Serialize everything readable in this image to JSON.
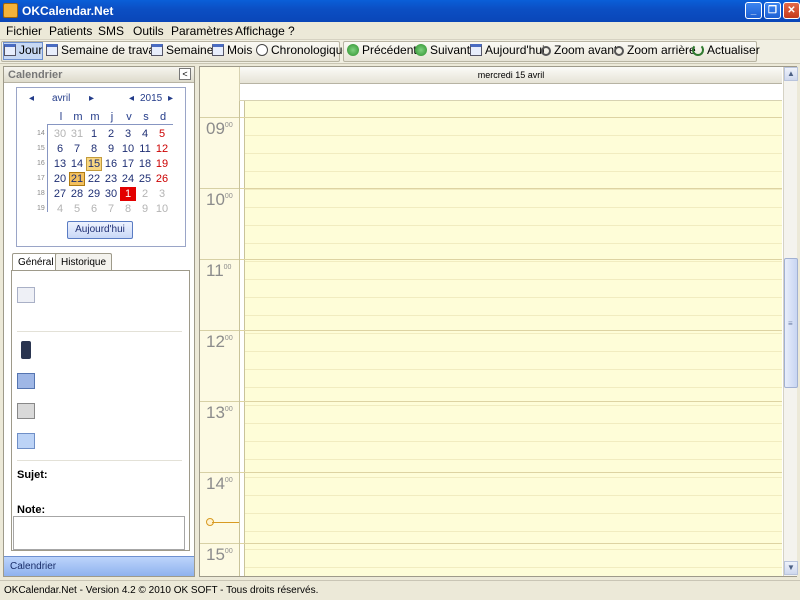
{
  "window": {
    "title": "OKCalendar.Net",
    "controls": [
      "_",
      "❐",
      "✕"
    ]
  },
  "menu": [
    "Fichier",
    "Patients",
    "SMS",
    "Outils",
    "Paramètres",
    "Affichage",
    "?"
  ],
  "toolbar": {
    "views": [
      "Jour",
      "Semaine de travail",
      "Semaine",
      "Mois",
      "Chronologique"
    ],
    "active_view": "Jour",
    "actions": [
      "Précédent",
      "Suivant",
      "Aujourd'hui",
      "Zoom avant",
      "Zoom arrière",
      "Actualiser"
    ]
  },
  "left_panel": {
    "header": "Calendrier",
    "collapse_glyph": "<",
    "calendar": {
      "month": "avril",
      "year": "2015",
      "nav_prev": "◂",
      "nav_next": "▸",
      "dow": [
        "l",
        "m",
        "m",
        "j",
        "v",
        "s",
        "d"
      ],
      "weeks": [
        {
          "num": "14",
          "days": [
            "30",
            "31",
            "1",
            "2",
            "3",
            "4",
            "5"
          ]
        },
        {
          "num": "15",
          "days": [
            "6",
            "7",
            "8",
            "9",
            "10",
            "11",
            "12"
          ]
        },
        {
          "num": "16",
          "days": [
            "13",
            "14",
            "15",
            "16",
            "17",
            "18",
            "19"
          ]
        },
        {
          "num": "17",
          "days": [
            "20",
            "21",
            "22",
            "23",
            "24",
            "25",
            "26"
          ]
        },
        {
          "num": "18",
          "days": [
            "27",
            "28",
            "29",
            "30",
            "1",
            "2",
            "3"
          ]
        },
        {
          "num": "19",
          "days": [
            "4",
            "5",
            "6",
            "7",
            "8",
            "9",
            "10"
          ]
        }
      ],
      "today_button": "Aujourd'hui"
    },
    "tabs": [
      "Général",
      "Historique"
    ],
    "active_tab": "Général",
    "subject_label": "Sujet:",
    "note_label": "Note:",
    "footer": "Calendrier"
  },
  "day_view": {
    "header": "mercredi 15 avril",
    "hours": [
      {
        "h": "09",
        "m": "00"
      },
      {
        "h": "10",
        "m": "00"
      },
      {
        "h": "11",
        "m": "00"
      },
      {
        "h": "12",
        "m": "00"
      },
      {
        "h": "13",
        "m": "00"
      },
      {
        "h": "14",
        "m": "00"
      },
      {
        "h": "15",
        "m": "00"
      }
    ]
  },
  "status_bar": "OKCalendar.Net - Version 4.2 © 2010 OK SOFT - Tous droits réservés.",
  "colors": {
    "title_bar": "#0b4fc4",
    "slot_background": "#fefdd8",
    "today_marker": "#f3c05e",
    "marked_day": "#e30000"
  }
}
